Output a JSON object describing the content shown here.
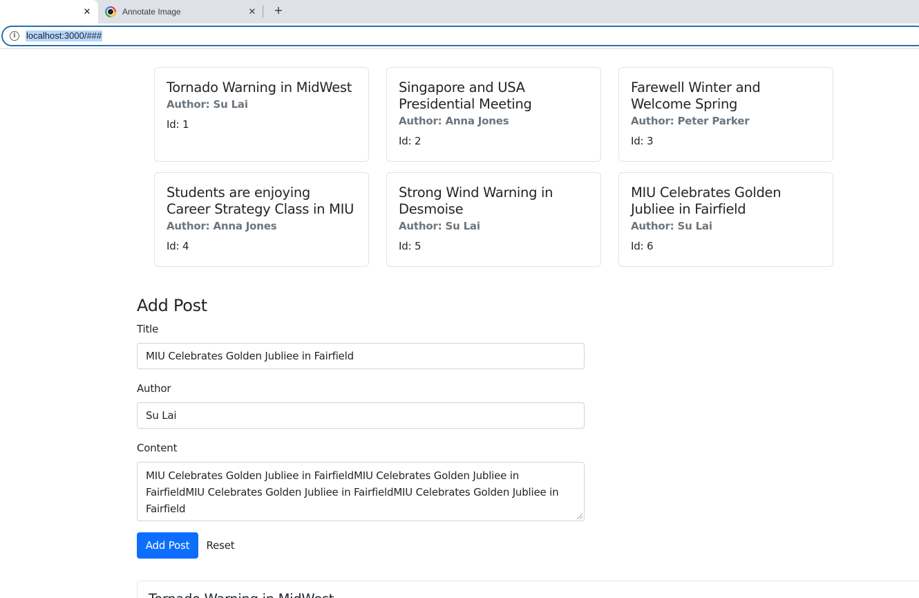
{
  "browser": {
    "tabs": [
      {
        "title": "",
        "active": true,
        "close_glyph": "✕"
      },
      {
        "title": "Annotate Image",
        "active": false,
        "close_glyph": "✕",
        "favicon": "chrome-like-icon"
      }
    ],
    "new_tab_glyph": "+",
    "url": "localhost:3000/###",
    "info_glyph": "i"
  },
  "posts": [
    {
      "title": "Tornado Warning in MidWest",
      "author": "Author: Su Lai",
      "id": "Id: 1"
    },
    {
      "title": "Singapore and USA Presidential Meeting",
      "author": "Author: Anna Jones",
      "id": "Id: 2"
    },
    {
      "title": "Farewell Winter and Welcome Spring",
      "author": "Author: Peter Parker",
      "id": "Id: 3"
    },
    {
      "title": "Students are enjoying Career Strategy Class in MIU",
      "author": "Author: Anna Jones",
      "id": "Id: 4"
    },
    {
      "title": "Strong Wind Warning in Desmoise",
      "author": "Author: Su Lai",
      "id": "Id: 5"
    },
    {
      "title": "MIU Celebrates Golden Jubliee in Fairfield",
      "author": "Author: Su Lai",
      "id": "Id: 6"
    }
  ],
  "form": {
    "heading": "Add Post",
    "title_label": "Title",
    "title_value": "MIU Celebrates Golden Jubliee in Fairfield",
    "author_label": "Author",
    "author_value": "Su Lai",
    "content_label": "Content",
    "content_value": "MIU Celebrates Golden Jubliee in FairfieldMIU Celebrates Golden Jubliee in FairfieldMIU Celebrates Golden Jubliee in FairfieldMIU Celebrates Golden Jubliee in Fairfield",
    "submit_label": "Add Post",
    "reset_label": "Reset"
  },
  "detail": {
    "title": "Tornado Warning in MidWest"
  },
  "colors": {
    "primary": "#0d6efd",
    "muted": "#6c757d",
    "url_highlight": "#b3d7ff",
    "omnibox_border": "#2b6ea8"
  }
}
